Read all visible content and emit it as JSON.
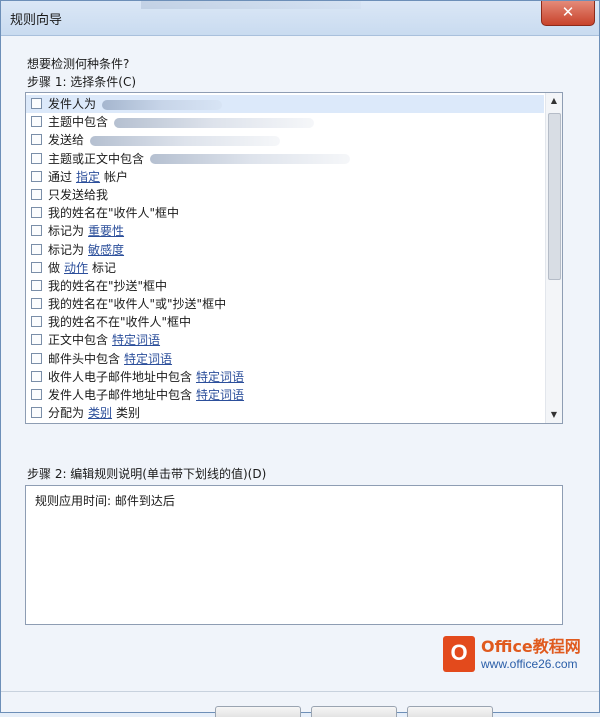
{
  "window": {
    "title": "规则向导",
    "close_label": "✕"
  },
  "question": "想要检测何种条件?",
  "step1": {
    "label": "步骤 1: 选择条件(C)",
    "conditions": [
      {
        "text": "发件人为",
        "checked": false,
        "selected": true
      },
      {
        "text": "主题中包含",
        "checked": false
      },
      {
        "text": "发送给",
        "checked": false
      },
      {
        "text": "主题或正文中包含",
        "checked": false
      },
      {
        "text": "通过",
        "link": "指定",
        "post": "帐户",
        "checked": false
      },
      {
        "text": "只发送给我",
        "checked": false
      },
      {
        "text": "我的姓名在\"收件人\"框中",
        "checked": false
      },
      {
        "text": "标记为",
        "link": "重要性",
        "checked": false
      },
      {
        "text": "标记为",
        "link": "敏感度",
        "checked": false
      },
      {
        "text": "做",
        "link": "动作",
        "post": "标记",
        "checked": false
      },
      {
        "text": "我的姓名在\"抄送\"框中",
        "checked": false
      },
      {
        "text": "我的姓名在\"收件人\"或\"抄送\"框中",
        "checked": false
      },
      {
        "text": "我的姓名不在\"收件人\"框中",
        "checked": false
      },
      {
        "text": "正文中包含",
        "link": "特定词语",
        "checked": false
      },
      {
        "text": "邮件头中包含",
        "link": "特定词语",
        "checked": false
      },
      {
        "text": "收件人电子邮件地址中包含",
        "link": "特定词语",
        "checked": false
      },
      {
        "text": "发件人电子邮件地址中包含",
        "link": "特定词语",
        "checked": false
      },
      {
        "text": "分配为",
        "link": "类别",
        "post": "类别",
        "checked": false
      }
    ]
  },
  "step2": {
    "label": "步骤 2: 编辑规则说明(单击带下划线的值)(D)",
    "description": "规则应用时间: 邮件到达后"
  },
  "watermark": {
    "logo_letter": "O",
    "name": "Office教程网",
    "url": "www.office26.com"
  },
  "colors": {
    "link": "#2c4f9b",
    "selection": "#dce9fa",
    "close_button": "#c8432b"
  }
}
